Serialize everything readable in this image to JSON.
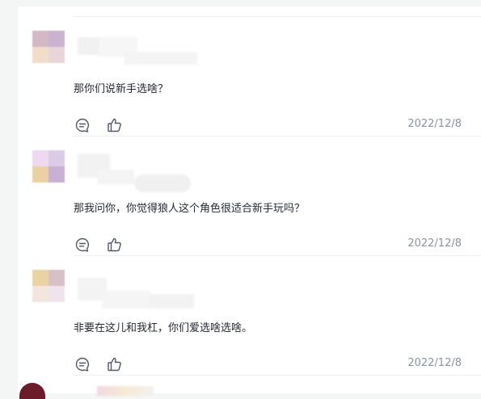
{
  "comments": [
    {
      "text": "那你们说新手选啥？",
      "date": "2022/12/8",
      "avatar_colors": [
        "#d2b9c4",
        "#c9b3d0",
        "#f2dec8",
        "#e9d5d9"
      ],
      "icons": [
        "comment-icon",
        "thumbs-up-icon"
      ]
    },
    {
      "text": "那我问你，你觉得狼人这个角色很适合新手玩吗？",
      "date": "2022/12/8",
      "avatar_colors": [
        "#efd9ef",
        "#dccbe6",
        "#ebd0a2",
        "#c7b0d3"
      ],
      "icons": [
        "comment-icon",
        "thumbs-up-icon"
      ]
    },
    {
      "text": "非要在这儿和我杠，你们爱选啥选啥。",
      "date": "2022/12/8",
      "avatar_colors": [
        "#e9d3a3",
        "#d7c0c6",
        "#f3e6df",
        "#efe4ec"
      ],
      "icons": [
        "comment-icon",
        "thumbs-up-icon"
      ]
    }
  ],
  "colors": {
    "text": "#252933",
    "date": "#8a919f",
    "icon": "#515767",
    "divider": "#eceff1",
    "page_bg": "#f4f5f5",
    "next_avatar": "#6b1b2a"
  }
}
